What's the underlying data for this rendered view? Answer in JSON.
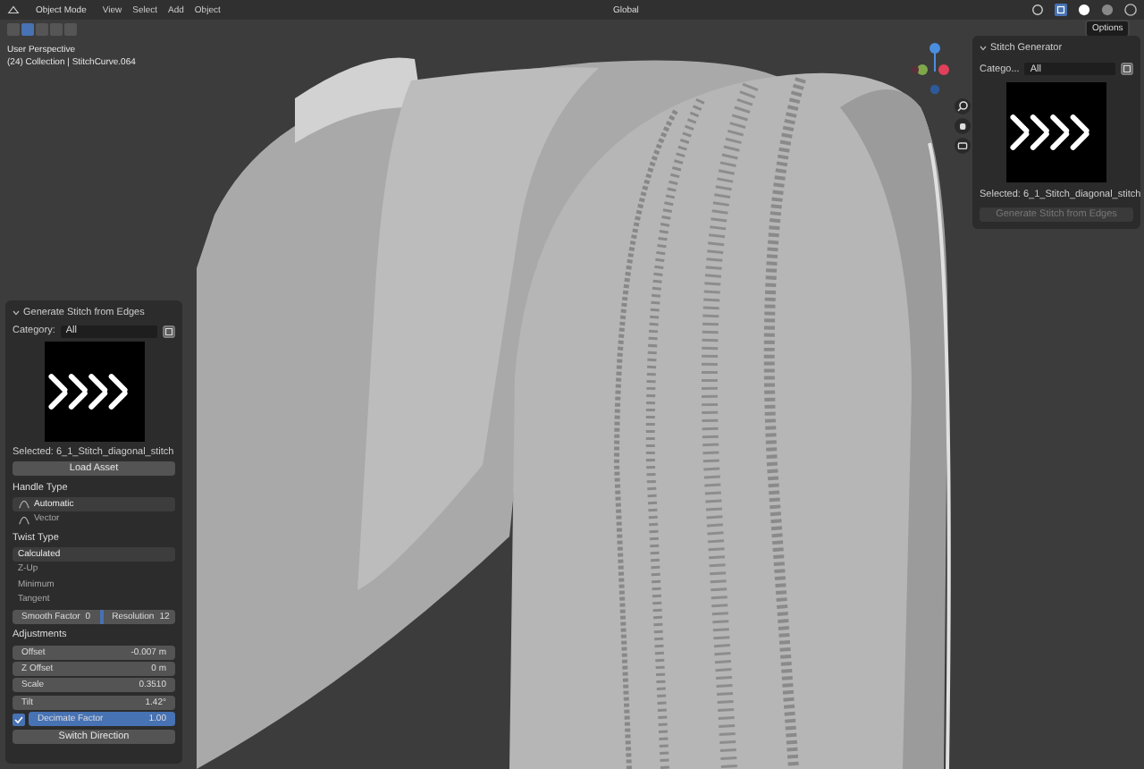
{
  "header": {
    "mode": "Object Mode",
    "menus": [
      "View",
      "Select",
      "Add",
      "Object"
    ],
    "orientation": "Global",
    "tooltip": "Options"
  },
  "viewport": {
    "title": "User Perspective",
    "subtitle": "(24) Collection | StitchCurve.064"
  },
  "tool_panel": {
    "title": "Generate Stitch from Edges",
    "expanded": true,
    "category_label": "Category:",
    "category": "All",
    "selected": "Selected: 6_1_Stitch_diagonal_stitch",
    "load_button": "Load Asset",
    "handle_type": {
      "label": "Handle Type",
      "options": [
        {
          "label": "Automatic",
          "selected": true
        },
        {
          "label": "Vector",
          "selected": false
        }
      ]
    },
    "twist_type": {
      "label": "Twist Type",
      "options": [
        {
          "label": "Calculated",
          "selected": true
        },
        {
          "label": "Z-Up",
          "selected": false
        },
        {
          "label": "Minimum",
          "selected": false
        },
        {
          "label": "Tangent",
          "selected": false
        }
      ]
    },
    "smooth_factor": {
      "label": "Smooth Factor",
      "value": "0"
    },
    "resolution": {
      "label": "Resolution",
      "value": "12"
    },
    "adjustments_label": "Adjustments",
    "offset_group": [
      {
        "label": "Offset",
        "value": "-0.007 m"
      },
      {
        "label": "Z Offset",
        "value": "0 m"
      }
    ],
    "scale": {
      "label": "Scale",
      "value": "0.3510"
    },
    "tilt": {
      "label": "Tilt",
      "value": "1.42°"
    },
    "decimate": {
      "label": "Decimate Factor",
      "value": "1.00",
      "level": 1,
      "checked": true
    },
    "switch_button": "Switch Direction"
  },
  "sidebar": {
    "title": "Stitch Generator",
    "expanded": true,
    "category_label": "Catego...",
    "category": "All",
    "selected": "Selected: 6_1_Stitch_diagonal_stitch",
    "generate_button": {
      "label": "Generate Stitch from Edges",
      "disabled": true
    }
  }
}
